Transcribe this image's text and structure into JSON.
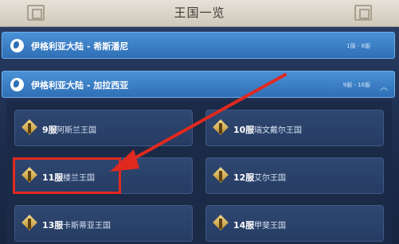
{
  "window": {
    "title": "王国一览"
  },
  "regions": [
    {
      "name": "伊格利亚大陆 - 希斯潘尼",
      "range": "1服 - 8服"
    },
    {
      "name": "伊格利亚大陆 - 加拉西亚",
      "range": "9服 - 16服"
    }
  ],
  "servers": [
    {
      "num": "9服",
      "name": "阿斯兰王国"
    },
    {
      "num": "10服",
      "name": "瑞文戴尔王国"
    },
    {
      "num": "11服",
      "name": "楼兰王国"
    },
    {
      "num": "12服",
      "name": "艾尔王国"
    },
    {
      "num": "13服",
      "name": "卡斯蒂亚王国"
    },
    {
      "num": "14服",
      "name": "甲斐王国"
    }
  ],
  "annotation": {
    "color": "#e0291f"
  }
}
